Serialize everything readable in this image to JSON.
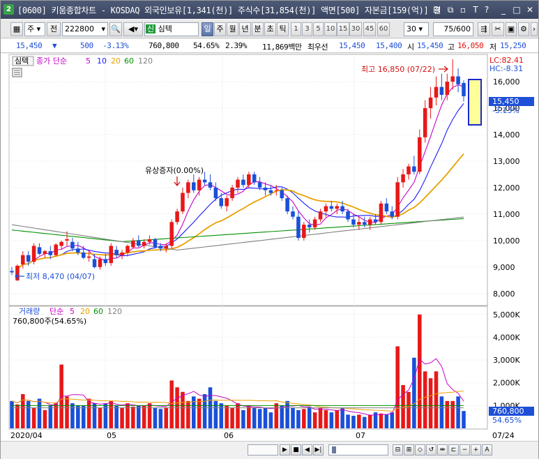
{
  "window": {
    "app_number": "2",
    "title": "[0600] 키움종합차트 - KOSDAQ 외국인보유[1,341(천)] 주식수[31,854(천)] 액면[500] 자본금[159(억)] 결"
  },
  "toolbar": {
    "period_type": "주",
    "prev_label": "전",
    "code": "222800",
    "credit_badge": "신",
    "stock_name": "심텍",
    "period_buttons": [
      "일",
      "주",
      "월",
      "년",
      "분",
      "초",
      "틱"
    ],
    "minute_buttons": [
      "1",
      "3",
      "5",
      "10",
      "15",
      "30",
      "45",
      "60"
    ],
    "interval_value": "30",
    "count": "75/600"
  },
  "quote": {
    "price": "15,450",
    "direction": "▼",
    "change": "500",
    "change_pct": "-3.13%",
    "volume": "760,800",
    "volume_ratio": "54.65%",
    "turnover": "2.39%",
    "amount": "11,869백만",
    "best_ask_label": "최우선",
    "ask": "15,450",
    "bid": "15,400",
    "open_label": "시",
    "open": "15,450",
    "high_label": "고",
    "high": "16,050",
    "low_label": "저",
    "low": "15,250"
  },
  "price_panel": {
    "name_tag": "심텍",
    "ma_label": "종가 단순",
    "ma_periods": [
      "5",
      "10",
      "20",
      "60",
      "120"
    ],
    "ma_colors": [
      "#c800c8",
      "#1a1aff",
      "#e8a000",
      "#009000",
      "#808080"
    ],
    "lc": "LC:82.41",
    "hc": "HC:-8.31",
    "current_price_tag": "15,450",
    "current_change_tag": "-3.13%",
    "max_note": "최고 16,850 (07/22)",
    "min_note": "최저 8,470 (04/07)",
    "event_note": "유상증자(0.00%)",
    "y_ticks": [
      "16,000",
      "15,000",
      "14,000",
      "13,000",
      "12,000",
      "11,000",
      "10,000",
      "9,000",
      "8,000"
    ]
  },
  "volume_panel": {
    "title": "거래량",
    "ma_label": "단순",
    "ma_periods": [
      "5",
      "20",
      "60",
      "120"
    ],
    "summary": "760,800주(54.65%)",
    "y_ticks": [
      "5,000K",
      "4,000K",
      "3,000K",
      "2,000K",
      "1,000K"
    ],
    "current_tag": "760,800",
    "current_pct": "54.65%"
  },
  "x_axis": {
    "labels": [
      "2020/04",
      "05",
      "06",
      "07",
      "07/24"
    ]
  },
  "colors": {
    "up": "#e81818",
    "down": "#1a50d8",
    "accent": "#1e4fd8"
  },
  "chart_data": {
    "type": "candlestick",
    "price_range": [
      7600,
      16950
    ],
    "volume_range_k": [
      0,
      5300
    ],
    "candles": [
      [
        8850,
        9000,
        8700,
        8800,
        0.0
      ],
      [
        8500,
        9100,
        8470,
        9050,
        0.0
      ],
      [
        9100,
        9600,
        8950,
        9450,
        0.0
      ],
      [
        9450,
        9600,
        9050,
        9200,
        0.0
      ],
      [
        9200,
        9900,
        9100,
        9800,
        0.0
      ],
      [
        9750,
        9900,
        9450,
        9500,
        0.0
      ],
      [
        9500,
        9650,
        9350,
        9600,
        0.0
      ],
      [
        9600,
        9800,
        9300,
        9450,
        0.0
      ],
      [
        9450,
        9900,
        9400,
        9850,
        0.0
      ],
      [
        9800,
        10000,
        9650,
        9950,
        0.0
      ],
      [
        10000,
        10350,
        9800,
        10050,
        0.0
      ],
      [
        9950,
        10100,
        9600,
        9700,
        0.0
      ],
      [
        9700,
        9950,
        9450,
        9550,
        0.0
      ],
      [
        9550,
        9800,
        9300,
        9350,
        0.0
      ],
      [
        9350,
        9600,
        9200,
        9400,
        0.0
      ],
      [
        9300,
        9500,
        8950,
        9000,
        0.0
      ],
      [
        9000,
        9400,
        8900,
        9300,
        0.0
      ],
      [
        9300,
        9500,
        9050,
        9150,
        0.0
      ],
      [
        9150,
        9900,
        9050,
        9800,
        0.0
      ],
      [
        9650,
        9800,
        9350,
        9450,
        0.0
      ],
      [
        9450,
        9650,
        9300,
        9550,
        0.0
      ],
      [
        9550,
        9850,
        9400,
        9800,
        0.0
      ],
      [
        9750,
        10100,
        9700,
        10000,
        0.0
      ],
      [
        10000,
        10200,
        9750,
        9800,
        0.0
      ],
      [
        9800,
        10050,
        9700,
        9950,
        0.0
      ],
      [
        9950,
        10200,
        9850,
        10050,
        0.0
      ],
      [
        10050,
        10100,
        9700,
        9750,
        0.0
      ],
      [
        9800,
        9900,
        9600,
        9700,
        0.0
      ],
      [
        9700,
        9900,
        9550,
        9800,
        0.0
      ],
      [
        9800,
        10800,
        9700,
        10700,
        0.0
      ],
      [
        10700,
        11200,
        10600,
        11100,
        0.0
      ],
      [
        11100,
        12000,
        11000,
        11800,
        0.0
      ],
      [
        11800,
        12300,
        11600,
        12200,
        0.0
      ],
      [
        12200,
        12500,
        11800,
        11900,
        0.0
      ],
      [
        11900,
        12400,
        11700,
        12300,
        0.0
      ],
      [
        12300,
        12600,
        12100,
        12200,
        0.0
      ],
      [
        12200,
        12500,
        11900,
        12000,
        0.0
      ],
      [
        12000,
        12200,
        11500,
        11600,
        0.0
      ],
      [
        11600,
        11800,
        11200,
        11300,
        0.0
      ],
      [
        11300,
        11700,
        11100,
        11600,
        0.0
      ],
      [
        11600,
        12100,
        11500,
        12000,
        0.0
      ],
      [
        12000,
        12400,
        11800,
        12300,
        0.0
      ],
      [
        12300,
        12500,
        12000,
        12100,
        0.0
      ],
      [
        12100,
        12600,
        12000,
        12500,
        0.0
      ],
      [
        12500,
        12600,
        12100,
        12200,
        0.0
      ],
      [
        12200,
        12400,
        11900,
        12000,
        0.0
      ],
      [
        12000,
        12200,
        11700,
        11900,
        0.0
      ],
      [
        11900,
        12100,
        11700,
        11800,
        0.0
      ],
      [
        11900,
        12100,
        11700,
        11900,
        0.0
      ],
      [
        11900,
        12000,
        11500,
        11600,
        0.0
      ],
      [
        11600,
        11700,
        11000,
        11100,
        0.0
      ],
      [
        11100,
        11300,
        10800,
        10900,
        0.0
      ],
      [
        10900,
        11100,
        10000,
        10100,
        0.0
      ],
      [
        10100,
        10700,
        10000,
        10600,
        0.0
      ],
      [
        10600,
        10800,
        10300,
        10500,
        0.0
      ],
      [
        10500,
        10900,
        10400,
        10800,
        0.0
      ],
      [
        10800,
        11200,
        10700,
        11100,
        0.0
      ],
      [
        11100,
        11400,
        10900,
        11300,
        0.0
      ],
      [
        11300,
        11500,
        11100,
        11200,
        0.0
      ],
      [
        11200,
        11400,
        11000,
        11300,
        0.0
      ],
      [
        11300,
        11500,
        11000,
        11100,
        0.0
      ],
      [
        11100,
        11200,
        10700,
        10800,
        0.0
      ],
      [
        10800,
        11000,
        10500,
        10600,
        0.0
      ],
      [
        10600,
        10900,
        10400,
        10700,
        0.0
      ],
      [
        10700,
        10900,
        10500,
        10600,
        0.0
      ],
      [
        10600,
        10900,
        10400,
        10800,
        0.0
      ],
      [
        10800,
        11000,
        10600,
        10700,
        0.0
      ],
      [
        10700,
        11500,
        10600,
        11400,
        0.0
      ],
      [
        11400,
        11600,
        11000,
        11100,
        0.0
      ],
      [
        11100,
        11300,
        10800,
        10900,
        0.0
      ],
      [
        10900,
        12400,
        10800,
        12200,
        0.0
      ],
      [
        12200,
        12700,
        12000,
        12500,
        0.0
      ],
      [
        12500,
        12900,
        12300,
        12800,
        0.0
      ],
      [
        12800,
        13200,
        12500,
        12600,
        0.0
      ],
      [
        12600,
        14200,
        12500,
        13900,
        0.0
      ],
      [
        13900,
        15300,
        13700,
        15000,
        0.0
      ],
      [
        15000,
        15800,
        14600,
        15400,
        0.0
      ],
      [
        15400,
        16200,
        15100,
        15800,
        0.0
      ],
      [
        15800,
        16300,
        15300,
        15500,
        0.0
      ],
      [
        15500,
        16300,
        15300,
        16000,
        0.0
      ],
      [
        16000,
        16850,
        15700,
        16200,
        0.0
      ],
      [
        16200,
        16500,
        15600,
        15900,
        0.0
      ],
      [
        15950,
        16050,
        15250,
        15450,
        0.0
      ]
    ],
    "volumes_k": [
      1200,
      1050,
      1500,
      1200,
      900,
      1300,
      800,
      1000,
      1100,
      2800,
      1400,
      1100,
      1000,
      1000,
      1300,
      1100,
      900,
      1100,
      1200,
      1000,
      900,
      1100,
      950,
      1000,
      1000,
      1100,
      900,
      850,
      900,
      2100,
      1800,
      1600,
      1200,
      1400,
      1300,
      1500,
      1800,
      1200,
      1100,
      1000,
      900,
      1100,
      800,
      1000,
      900,
      850,
      900,
      700,
      1100,
      1000,
      1200,
      900,
      800,
      850,
      950,
      700,
      900,
      800,
      700,
      800,
      900,
      600,
      550,
      600,
      500,
      600,
      700,
      650,
      600,
      700,
      3600,
      1900,
      1600,
      3100,
      5000,
      2500,
      2200,
      2500,
      1400,
      1200,
      1200,
      1400,
      760
    ]
  }
}
